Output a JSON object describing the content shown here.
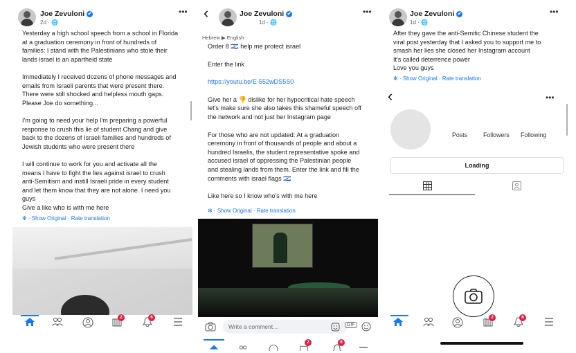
{
  "author": {
    "name": "Joe Zevuloni",
    "verified_mark": "✔"
  },
  "panel1": {
    "meta": "2d · 🌐",
    "post_lines": [
      "Yesterday a high school speech from a school in Florida",
      "at a graduation ceremony in front of hundreds of",
      "families: I stand with the Palestinians who stole their",
      "lands israel is an apartheid state",
      "",
      "Immediately I received dozens of phone messages and",
      "emails from Israeli parents that were present there.",
      "There were still shocked and helpless mouth gaps.",
      "Please Joe do something...",
      "",
      "I'm going to need your help I'm preparing a powerful",
      "response to crush this lie of student Chang and give",
      "back to the dozens of Israeli families and hundreds of",
      "Jewish students who were present there",
      "",
      "I will continue to work for you and activate all the",
      "means I have to fight the lies against israel to crush",
      "anti-Semitism and instill Israeli pride in every student",
      "and let them know that they are not alone. I need you",
      "guys",
      "Give a like who is with me here"
    ],
    "show_original": "Show Original",
    "rate_translation": "Rate translation",
    "badges": {
      "menu": "2",
      "notifications": "6"
    }
  },
  "panel2": {
    "meta": "1d · 🌐",
    "lang_row": "Hebrew ▶ English",
    "order_line": "Order 8 🇮🇱 help me protect israel",
    "enter_link": "Enter the link",
    "link": "https://youtu.be/E-552wDS5S0",
    "para2_lines": [
      "Give her a 👎 dislike for her hypocritical hate speech",
      "let's make sure she also takes this shameful speech off",
      "the network and not just her Instagram page"
    ],
    "para3_lines": [
      "For those who are not updated: At a graduation",
      "ceremony in front of thousands of people and about a",
      "hundred Israelis, the student representative spoke and",
      "accused israel of oppressing the Palestinian people",
      "and stealing lands from them. Enter the link and fill the",
      "comments with israel flags 🇮🇱"
    ],
    "like_line": "Like here so I know who's with me here",
    "show_original": "Show Original",
    "rate_translation": "Rate translation",
    "comment_placeholder": "Write a comment...",
    "gif_label": "GIF",
    "badges": {
      "menu": "2",
      "notifications": "6"
    }
  },
  "panel3": {
    "meta": "1d · 🌐",
    "post_lines": [
      "After they gave the anti-Semitic Chinese student the",
      "viral post yesterday that I asked you to support me to",
      "smash her lies she closed her Instagram account",
      "It's called deterrence power",
      "Love you guys"
    ],
    "show_original": "Show Original",
    "rate_translation": "Rate translation",
    "insta": {
      "posts": "Posts",
      "followers": "Followers",
      "following": "Following",
      "loading": "Loading"
    },
    "badges": {
      "menu": "2",
      "notifications": "6"
    }
  },
  "icons": {
    "more": "•••",
    "back": "‹",
    "gear": "✻"
  },
  "colors": {
    "fb_blue": "#1877f2",
    "badge_red": "#e41e3f"
  }
}
